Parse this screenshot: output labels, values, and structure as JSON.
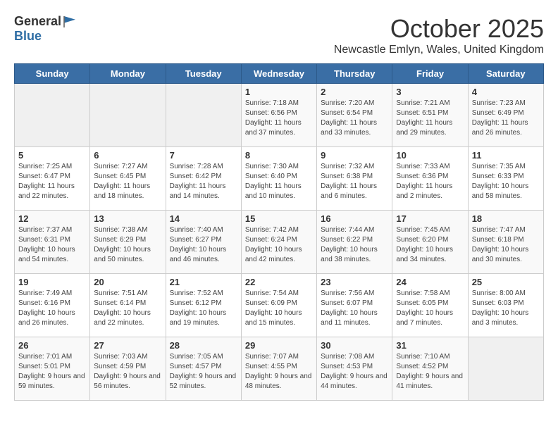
{
  "logo": {
    "general": "General",
    "blue": "Blue"
  },
  "title": {
    "month": "October 2025",
    "location": "Newcastle Emlyn, Wales, United Kingdom"
  },
  "weekdays": [
    "Sunday",
    "Monday",
    "Tuesday",
    "Wednesday",
    "Thursday",
    "Friday",
    "Saturday"
  ],
  "weeks": [
    [
      {
        "day": "",
        "content": ""
      },
      {
        "day": "",
        "content": ""
      },
      {
        "day": "",
        "content": ""
      },
      {
        "day": "1",
        "content": "Sunrise: 7:18 AM\nSunset: 6:56 PM\nDaylight: 11 hours\nand 37 minutes."
      },
      {
        "day": "2",
        "content": "Sunrise: 7:20 AM\nSunset: 6:54 PM\nDaylight: 11 hours\nand 33 minutes."
      },
      {
        "day": "3",
        "content": "Sunrise: 7:21 AM\nSunset: 6:51 PM\nDaylight: 11 hours\nand 29 minutes."
      },
      {
        "day": "4",
        "content": "Sunrise: 7:23 AM\nSunset: 6:49 PM\nDaylight: 11 hours\nand 26 minutes."
      }
    ],
    [
      {
        "day": "5",
        "content": "Sunrise: 7:25 AM\nSunset: 6:47 PM\nDaylight: 11 hours\nand 22 minutes."
      },
      {
        "day": "6",
        "content": "Sunrise: 7:27 AM\nSunset: 6:45 PM\nDaylight: 11 hours\nand 18 minutes."
      },
      {
        "day": "7",
        "content": "Sunrise: 7:28 AM\nSunset: 6:42 PM\nDaylight: 11 hours\nand 14 minutes."
      },
      {
        "day": "8",
        "content": "Sunrise: 7:30 AM\nSunset: 6:40 PM\nDaylight: 11 hours\nand 10 minutes."
      },
      {
        "day": "9",
        "content": "Sunrise: 7:32 AM\nSunset: 6:38 PM\nDaylight: 11 hours\nand 6 minutes."
      },
      {
        "day": "10",
        "content": "Sunrise: 7:33 AM\nSunset: 6:36 PM\nDaylight: 11 hours\nand 2 minutes."
      },
      {
        "day": "11",
        "content": "Sunrise: 7:35 AM\nSunset: 6:33 PM\nDaylight: 10 hours\nand 58 minutes."
      }
    ],
    [
      {
        "day": "12",
        "content": "Sunrise: 7:37 AM\nSunset: 6:31 PM\nDaylight: 10 hours\nand 54 minutes."
      },
      {
        "day": "13",
        "content": "Sunrise: 7:38 AM\nSunset: 6:29 PM\nDaylight: 10 hours\nand 50 minutes."
      },
      {
        "day": "14",
        "content": "Sunrise: 7:40 AM\nSunset: 6:27 PM\nDaylight: 10 hours\nand 46 minutes."
      },
      {
        "day": "15",
        "content": "Sunrise: 7:42 AM\nSunset: 6:24 PM\nDaylight: 10 hours\nand 42 minutes."
      },
      {
        "day": "16",
        "content": "Sunrise: 7:44 AM\nSunset: 6:22 PM\nDaylight: 10 hours\nand 38 minutes."
      },
      {
        "day": "17",
        "content": "Sunrise: 7:45 AM\nSunset: 6:20 PM\nDaylight: 10 hours\nand 34 minutes."
      },
      {
        "day": "18",
        "content": "Sunrise: 7:47 AM\nSunset: 6:18 PM\nDaylight: 10 hours\nand 30 minutes."
      }
    ],
    [
      {
        "day": "19",
        "content": "Sunrise: 7:49 AM\nSunset: 6:16 PM\nDaylight: 10 hours\nand 26 minutes."
      },
      {
        "day": "20",
        "content": "Sunrise: 7:51 AM\nSunset: 6:14 PM\nDaylight: 10 hours\nand 22 minutes."
      },
      {
        "day": "21",
        "content": "Sunrise: 7:52 AM\nSunset: 6:12 PM\nDaylight: 10 hours\nand 19 minutes."
      },
      {
        "day": "22",
        "content": "Sunrise: 7:54 AM\nSunset: 6:09 PM\nDaylight: 10 hours\nand 15 minutes."
      },
      {
        "day": "23",
        "content": "Sunrise: 7:56 AM\nSunset: 6:07 PM\nDaylight: 10 hours\nand 11 minutes."
      },
      {
        "day": "24",
        "content": "Sunrise: 7:58 AM\nSunset: 6:05 PM\nDaylight: 10 hours\nand 7 minutes."
      },
      {
        "day": "25",
        "content": "Sunrise: 8:00 AM\nSunset: 6:03 PM\nDaylight: 10 hours\nand 3 minutes."
      }
    ],
    [
      {
        "day": "26",
        "content": "Sunrise: 7:01 AM\nSunset: 5:01 PM\nDaylight: 9 hours\nand 59 minutes."
      },
      {
        "day": "27",
        "content": "Sunrise: 7:03 AM\nSunset: 4:59 PM\nDaylight: 9 hours\nand 56 minutes."
      },
      {
        "day": "28",
        "content": "Sunrise: 7:05 AM\nSunset: 4:57 PM\nDaylight: 9 hours\nand 52 minutes."
      },
      {
        "day": "29",
        "content": "Sunrise: 7:07 AM\nSunset: 4:55 PM\nDaylight: 9 hours\nand 48 minutes."
      },
      {
        "day": "30",
        "content": "Sunrise: 7:08 AM\nSunset: 4:53 PM\nDaylight: 9 hours\nand 44 minutes."
      },
      {
        "day": "31",
        "content": "Sunrise: 7:10 AM\nSunset: 4:52 PM\nDaylight: 9 hours\nand 41 minutes."
      },
      {
        "day": "",
        "content": ""
      }
    ]
  ]
}
